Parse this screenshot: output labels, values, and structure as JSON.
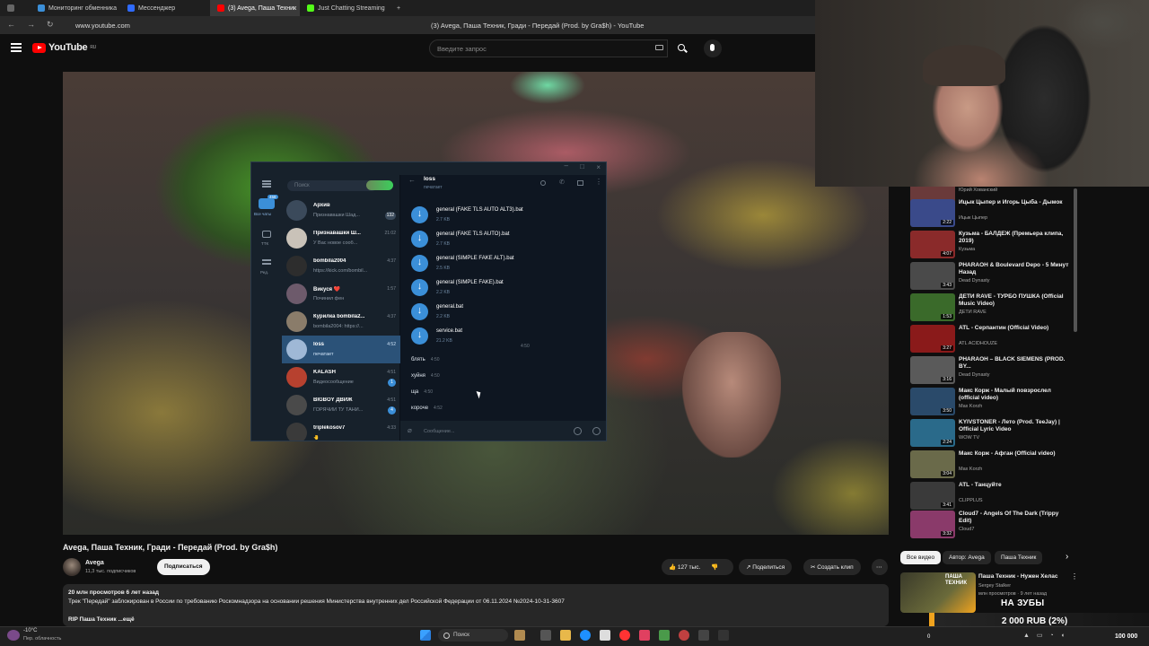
{
  "browser": {
    "tabs": [
      {
        "label": "Мониторинг обменника",
        "color": "#3b8fd8"
      },
      {
        "label": "Мессенджер",
        "color": "#2f6bff"
      },
      {
        "label": "(3) Avega, Паша Техник",
        "color": "#ff0000"
      },
      {
        "label": "Just Chatting Streaming",
        "color": "#53fc18"
      }
    ],
    "url": "www.youtube.com",
    "page_title": "(3) Avega, Паша Техник, Гради - Передай (Prod. by Gra$h) - YouTube"
  },
  "youtube": {
    "logo_text": "YouTube",
    "logo_region": "RU",
    "search_placeholder": "Введите запрос"
  },
  "telegram": {
    "search_placeholder": "Поиск",
    "rail": {
      "all_chats": "Все чаты",
      "all_chats_badge": "458",
      "folder2_label": "ТТК",
      "folder3_label": "Ред."
    },
    "chats": [
      {
        "name": "Архив",
        "preview": "Признавашки Шад...",
        "time": "",
        "badge": "132",
        "color": "#3b4a5b"
      },
      {
        "name": "Признавашки Ш...",
        "preview": "У Вас новое сооб...",
        "time": "21:02",
        "badge": "",
        "color": "#c9c2b8"
      },
      {
        "name": "bombila2004",
        "preview": "https://kick.com/bombil...",
        "time": "4:37",
        "badge": "",
        "color": "#2d2d2d"
      },
      {
        "name": "Викуся ❤️",
        "preview": "Починил фен",
        "time": "1:57",
        "badge": "",
        "color": "#6d5a6b"
      },
      {
        "name": "Курилка bombila2...",
        "preview": "bombila2004: https://...",
        "time": "4:37",
        "badge": "",
        "color": "#8a7c6a"
      },
      {
        "name": "loss",
        "preview": "печатает",
        "time": "4:52",
        "badge": "",
        "color": "#9fb8d6"
      },
      {
        "name": "KALASH",
        "preview": "Видеосообщение",
        "time": "4:51",
        "badge": "1",
        "color": "#b7412f"
      },
      {
        "name": "BIGBOY ДВИЖ",
        "preview": "ГОРЯЧИЙ ТУ ТАНИ...",
        "time": "4:51",
        "badge": "4",
        "color": "#4a4a4a"
      },
      {
        "name": "triplekosov7",
        "preview": "🤚",
        "time": "4:33",
        "badge": "",
        "color": "#3a3a3a"
      }
    ],
    "conversation": {
      "title": "loss",
      "status": "печатает",
      "files": [
        {
          "name": "general (FAKE TLS AUTO ALT3).bat",
          "size": "2.7 KB"
        },
        {
          "name": "general (FAKE TLS AUTO).bat",
          "size": "2.7 KB"
        },
        {
          "name": "general (SIMPLE FAKE ALT).bat",
          "size": "2.5 KB"
        },
        {
          "name": "general (SIMPLE FAKE).bat",
          "size": "2.2 KB"
        },
        {
          "name": "general.bat",
          "size": "2.2 KB"
        },
        {
          "name": "service.bat",
          "size": "21.2 KB"
        }
      ],
      "files_time": "4:50",
      "messages": [
        {
          "text": "блять",
          "time": "4:50"
        },
        {
          "text": "хуйня",
          "time": "4:50"
        },
        {
          "text": "ща",
          "time": "4:50"
        },
        {
          "text": "короче",
          "time": "4:52"
        }
      ],
      "input_placeholder": "Сообщение..."
    }
  },
  "recommendations": [
    {
      "title": "",
      "channel": "Юрий Хованский",
      "duration": "",
      "color": "#6a3a3a"
    },
    {
      "title": "Ицык Цыпер и Игорь Цыба - Дымок",
      "channel": "Ицык Цыпер",
      "duration": "2:22",
      "color": "#3a4a8a"
    },
    {
      "title": "Кузьма - БАЛДЕЖ (Премьера клипа, 2019)",
      "channel": "Кузьма",
      "duration": "4:07",
      "color": "#8a2a2a"
    },
    {
      "title": "PHARAOH & Boulevard Depo - 5 Минут Назад",
      "channel": "Dead Dynasty",
      "duration": "3:43",
      "color": "#4a4a4a"
    },
    {
      "title": "ДЕТИ RAVE - ТУРБО ПУШКА (Official Music Video)",
      "channel": "ДЕТИ RAVE",
      "duration": "1:53",
      "color": "#3a6a2a"
    },
    {
      "title": "ATL - Серпантин (Official Video)",
      "channel": "ATL ACIDHOUZE",
      "duration": "3:27",
      "color": "#8a1a1a"
    },
    {
      "title": "PHARAOH – BLACK SIEMENS (PROD. BY...",
      "channel": "Dead Dynasty",
      "duration": "3:16",
      "color": "#5a5a5a"
    },
    {
      "title": "Макс Корж - Малый повзрослел (official video)",
      "channel": "Max Korzh",
      "duration": "3:50",
      "color": "#2a4a6a"
    },
    {
      "title": "KYIVSTONER - Лето (Prod. TeeJay) | Official Lyric Video",
      "channel": "WOW TV",
      "duration": "2:24",
      "color": "#2a6a8a"
    },
    {
      "title": "Макс Корж - Афган (Official video)",
      "channel": "Max Korzh",
      "duration": "3:04",
      "color": "#6a6a4a"
    },
    {
      "title": "ATL - Танцуйте",
      "channel": "CLIPPLUS",
      "duration": "3:41",
      "color": "#3a3a3a"
    },
    {
      "title": "Cloud7 - Angels Of The Dark (Trippy Edit)",
      "channel": "Cloud7",
      "duration": "3:32",
      "color": "#8a3a6a"
    }
  ],
  "chips": [
    "Все видео",
    "Автор: Avega",
    "Паша Техник"
  ],
  "bottom_rec": {
    "title": "Паша Техник - Нужен Хелас",
    "channel": "Sergey Stalker",
    "meta": "млн просмотров · 9 лет назад",
    "thumb_label": "ПАША ТЕХНИК"
  },
  "video": {
    "title": "Avega, Паша Техник, Гради - Передай (Prod. by Gra$h)",
    "channel": "Avega",
    "subscribers": "11,3 тыс. подписчиков",
    "subscribe_label": "Подписаться",
    "likes": "127 тыс.",
    "share_label": "Поделиться",
    "clip_label": "Создать клип",
    "views_line": "20 млн просмотров  6 лет назад",
    "description": "Трек \"Передай\" заблокирован в России по требованию Роскомнадзора на основании решения Министерства внутренних дел Российской Федерации от 06.11.2024 №2024-10-31-3607",
    "tags_line": "RIP Паша Техник",
    "more_label": "...ещё"
  },
  "donation": {
    "label": "НА ЗУБЫ",
    "amount": "2 000 RUB (2%)",
    "progress_percent": 2
  },
  "taskbar": {
    "weather_temp": "-10°C",
    "weather_desc": "Пер. облачность",
    "search_label": "Поиск",
    "tray_left": "0",
    "right_amount": "100 000"
  },
  "colors": {
    "youtube_red": "#ff0000",
    "telegram_accent": "#3b8fd8",
    "donation_bar": "#f0a31e"
  }
}
